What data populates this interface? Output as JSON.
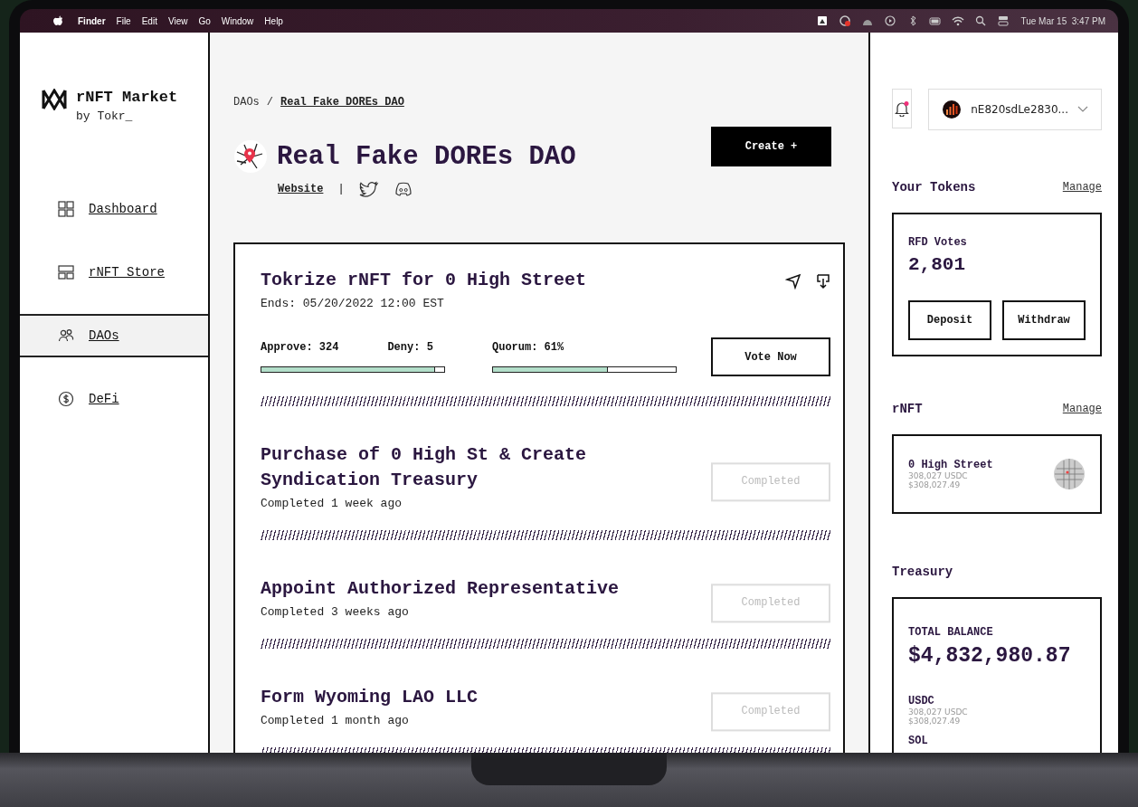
{
  "menu_bar": {
    "app": "Finder",
    "items": [
      "File",
      "Edit",
      "View",
      "Go",
      "Window",
      "Help"
    ],
    "clock": "Tue Mar 15  3:47 PM"
  },
  "sidebar": {
    "brand": {
      "name": "rNFT Market",
      "byline": "by Tokr_"
    },
    "items": [
      {
        "label": "Dashboard",
        "kind": "grid",
        "selected": false
      },
      {
        "label": "rNFT Store",
        "kind": "layout",
        "selected": false
      },
      {
        "label": "DAOs",
        "kind": "people",
        "selected": true
      },
      {
        "label": "DeFi",
        "kind": "dollar",
        "selected": false
      }
    ]
  },
  "breadcrumb": {
    "parent": "DAOs",
    "separator": "/",
    "current": "Real Fake DOREs DAO"
  },
  "dao": {
    "title": "Real Fake DOREs DAO",
    "website": "Website",
    "separator": "|",
    "create_button": "Create +"
  },
  "proposals": [
    {
      "kind": "active",
      "title": "Tokrize rNFT for 0 High Street",
      "subtitle": "Ends: 05/20/2022  12:00 EST",
      "approve": "Approve: 324",
      "deny": "Deny: 5",
      "quorum": "Quorum: 61%",
      "approve_meter": {
        "level": 0.95
      },
      "quorum_meter": {
        "level": 0.63
      },
      "action": "Vote Now"
    },
    {
      "kind": "completed",
      "title": "Purchase of 0 High St & Create Syndication Treasury",
      "subtitle": "Completed 1 week ago",
      "action": "Completed"
    },
    {
      "kind": "completed",
      "title": "Appoint Authorized Representative",
      "subtitle": "Completed 3 weeks ago",
      "action": "Completed"
    },
    {
      "kind": "completed",
      "title": "Form Wyoming LAO LLC",
      "subtitle": "Completed 1 month ago",
      "action": "Completed"
    }
  ],
  "account": {
    "has_notification": true,
    "address": "nE820sdLe2830..."
  },
  "tokens": {
    "heading": "Your Tokens",
    "manage": "Manage",
    "label": "RFD Votes",
    "amount": "2,801",
    "buttons": [
      "Deposit",
      "Withdraw"
    ]
  },
  "rnft": {
    "heading": "rNFT",
    "manage": "Manage",
    "items": [
      {
        "name": "0 High Street",
        "amount": "308,027 USDC",
        "value": "$308,027.49"
      }
    ]
  },
  "treasury": {
    "heading": "Treasury",
    "total_label": "TOTAL BALANCE",
    "total": "$4,832,980.87",
    "assets": [
      {
        "name": "USDC",
        "amount": "308,027 USDC",
        "value": "$308,027.49"
      },
      {
        "name": "SOL"
      }
    ]
  }
}
